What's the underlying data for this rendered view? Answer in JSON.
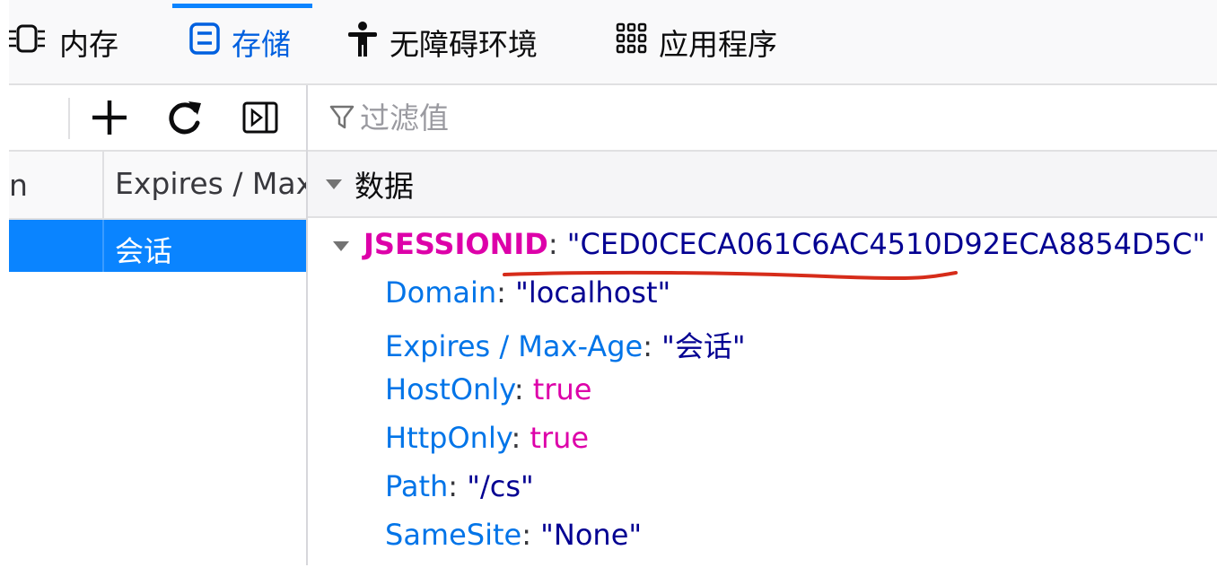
{
  "tabs": [
    {
      "label": "内存",
      "icon": "memory-chip-icon",
      "selected": false
    },
    {
      "label": "存储",
      "icon": "storage-icon",
      "selected": true
    },
    {
      "label": "无障碍环境",
      "icon": "accessibility-icon",
      "selected": false
    },
    {
      "label": "应用程序",
      "icon": "app-grid-icon",
      "selected": false
    }
  ],
  "left_toolbar": {
    "add_icon": "plus-icon",
    "refresh_icon": "refresh-icon",
    "sidebar_icon": "sidebar-toggle-icon"
  },
  "table": {
    "columns": [
      "n",
      "Expires / Max"
    ],
    "rows": [
      {
        "cells": [
          "",
          "会话"
        ],
        "selected": true
      }
    ]
  },
  "filter": {
    "placeholder": "过滤值",
    "icon": "filter-icon"
  },
  "detail": {
    "section_label": "数据",
    "root_key": "JSESSIONID",
    "root_value": "\"CED0CECA061C6AC4510D92ECA8854D5C\"",
    "properties": [
      {
        "key": "Domain",
        "value": "\"localhost\"",
        "type": "string"
      },
      {
        "key": "Expires / Max-Age",
        "value": "\"会话\"",
        "type": "string"
      },
      {
        "key": "HostOnly",
        "value": "true",
        "type": "bool"
      },
      {
        "key": "HttpOnly",
        "value": "true",
        "type": "bool"
      },
      {
        "key": "Path",
        "value": "\"/cs\"",
        "type": "string"
      },
      {
        "key": "SameSite",
        "value": "\"None\"",
        "type": "string"
      }
    ]
  },
  "colors": {
    "accent": "#0a84ff",
    "key_root": "#dd00a9",
    "key_prop": "#0074e8",
    "string_value": "#030092",
    "annotation": "#d62c1a"
  }
}
